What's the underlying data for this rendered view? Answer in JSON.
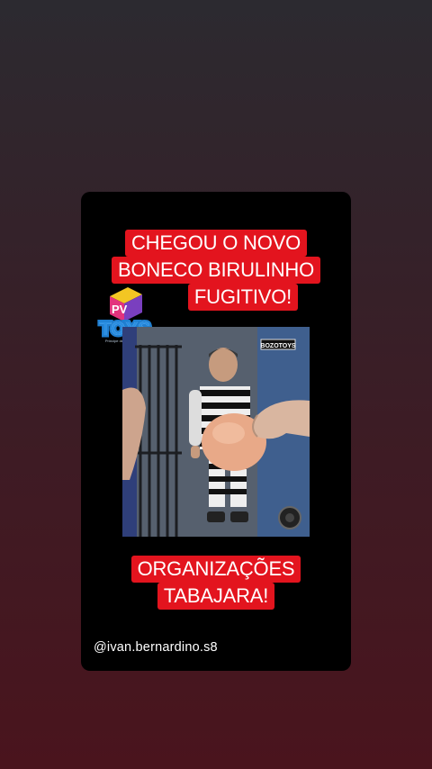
{
  "story": {
    "headline_lines": [
      "CHEGOU O NOVO",
      "BONECO BIRULINHO",
      "FUGITIVO!"
    ],
    "logo": {
      "top_letters": "PV",
      "word": "TOYS",
      "tagline": "Príncipe de Bí Pequenos"
    },
    "box_brand": "BOZOTOYS",
    "bottom_lines": [
      "ORGANIZAÇÕES",
      "TABAJARA!"
    ],
    "handle": "@ivan.bernardino.s8"
  },
  "colors": {
    "label_red": "#e3141e",
    "card_bg": "#000000",
    "page_gradient_top": "#2c2a30",
    "page_gradient_bottom": "#4a141d"
  }
}
